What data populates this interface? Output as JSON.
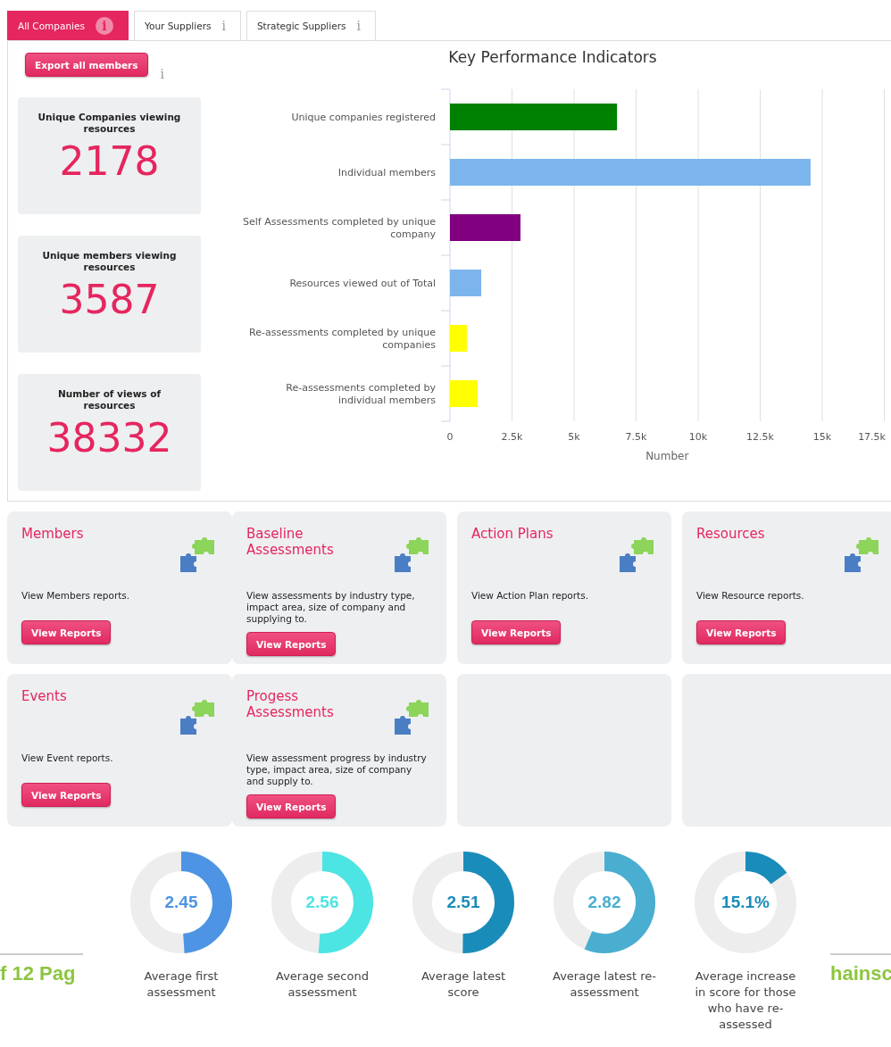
{
  "tabs": [
    {
      "label": "All Companies",
      "selected": true,
      "info": "i"
    },
    {
      "label": "Your Suppliers",
      "selected": false,
      "info": "i"
    },
    {
      "label": "Strategic Suppliers",
      "selected": false,
      "info": "i"
    }
  ],
  "export": {
    "label": "Export all members",
    "info": "i"
  },
  "stats": [
    {
      "label": "Unique Companies viewing resources",
      "value": "2178"
    },
    {
      "label": "Unique members viewing resources",
      "value": "3587"
    },
    {
      "label": "Number of views of resources",
      "value": "38332"
    }
  ],
  "kpi": {
    "chart_data": {
      "type": "bar",
      "orientation": "horizontal",
      "title": "Key Performance Indicators",
      "xlabel": "Number",
      "categories": [
        "Unique companies registered",
        "Individual members",
        "Self Assessments completed by unique company",
        "Resources viewed out of Total",
        "Re-assessments completed by unique companies",
        "Re-assessments completed by individual members"
      ],
      "series": [
        {
          "values": [
            6730,
            14530,
            2840,
            1260,
            680,
            1110
          ]
        }
      ],
      "grid": true,
      "colors": [
        "#008000",
        "#7cb5ec",
        "#800080",
        "#7cb5ec",
        "#ffff00",
        "#ffff00"
      ],
      "xlim": [
        0,
        17500
      ],
      "xticks": [
        {
          "value": 0,
          "label": "0"
        },
        {
          "value": 2500,
          "label": "2.5k"
        },
        {
          "value": 5000,
          "label": "5k"
        },
        {
          "value": 7500,
          "label": "7.5k"
        },
        {
          "value": 10000,
          "label": "10k"
        },
        {
          "value": 12500,
          "label": "12.5k"
        },
        {
          "value": 15000,
          "label": "15k"
        },
        {
          "value": 17500,
          "label": "17.5k"
        }
      ]
    }
  },
  "reports": [
    {
      "kind": "report",
      "title": "Members",
      "description": "View Members reports.",
      "button": "View Reports"
    },
    {
      "kind": "report",
      "title": "Baseline Assessments",
      "description": "View assessments by industry type, impact area, size of company and supplying to.",
      "button": "View Reports"
    },
    {
      "kind": "report",
      "title": "Action Plans",
      "description": "View Action Plan reports.",
      "button": "View Reports"
    },
    {
      "kind": "report",
      "title": "Resources",
      "description": "View Resource reports.",
      "button": "View Reports"
    },
    {
      "kind": "report",
      "title": "Events",
      "description": "View Event reports.",
      "button": "View Reports"
    },
    {
      "kind": "report",
      "title": "Progess Assessments",
      "description": "View assessment progress by industry type, impact area, size of company and supply to.",
      "button": "View Reports"
    },
    {
      "kind": "empty"
    },
    {
      "kind": "empty"
    }
  ],
  "side_texts": [
    "f 12 Pag",
    "hainsc"
  ],
  "gauges": [
    {
      "value": "2.45",
      "label": "Average first assessment",
      "color": "#4d94e4"
    },
    {
      "value": "2.56",
      "label": "Average second assessment",
      "color": "#4de4e4"
    },
    {
      "value": "2.51",
      "label": "Average latest score",
      "color": "#1a8cba"
    },
    {
      "value": "2.82",
      "label": "Average latest re-assessment",
      "color": "#4aaed0"
    },
    {
      "value": "15.1%",
      "label": "Average increase in score for those who have re-assessed",
      "color": "#1a8cba"
    }
  ]
}
